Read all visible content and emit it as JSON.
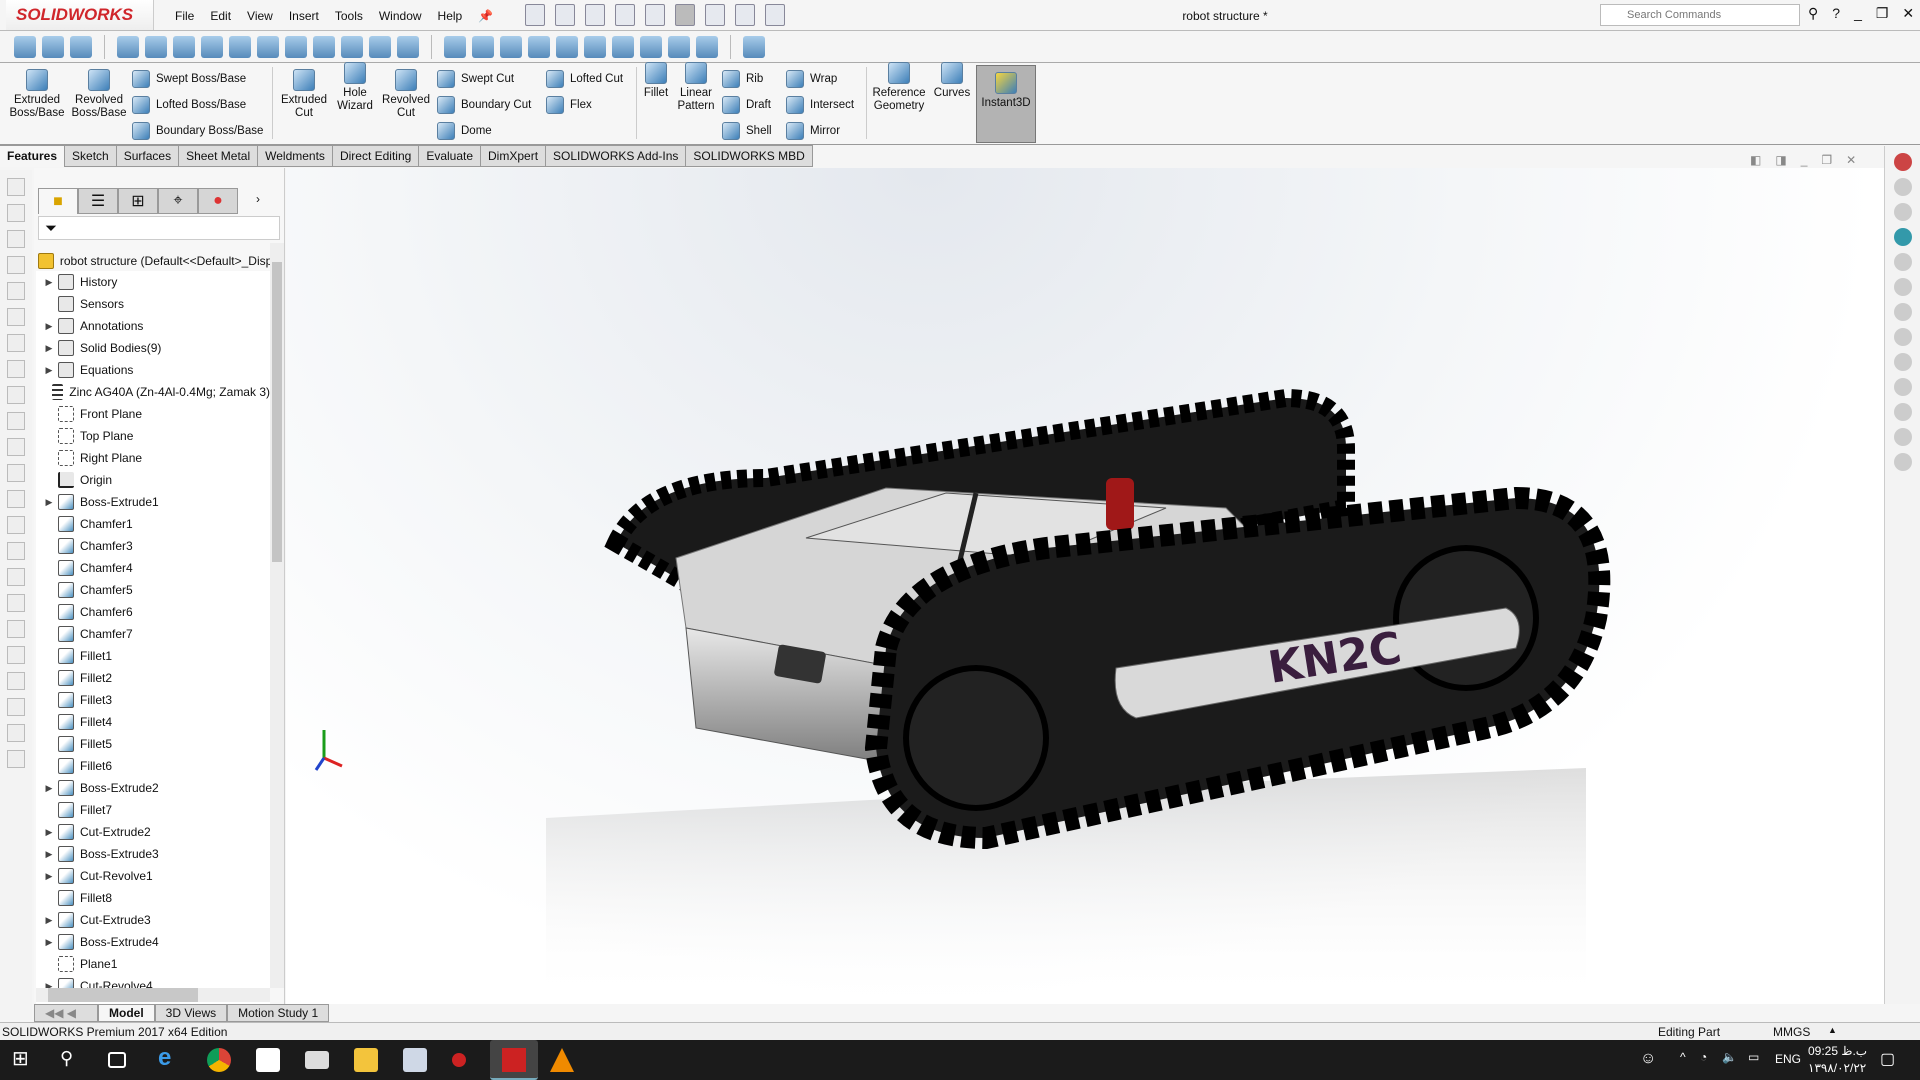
{
  "app": {
    "brand": "SOLIDWORKS",
    "title": "robot structure *",
    "search_placeholder": "Search Commands",
    "brand_color": "#d0262b"
  },
  "menus": [
    "File",
    "Edit",
    "View",
    "Insert",
    "Tools",
    "Window",
    "Help"
  ],
  "ribbon": {
    "large": [
      "Extruded Boss/Base",
      "Revolved Boss/Base",
      "Extruded Cut",
      "Hole Wizard",
      "Revolved Cut",
      "Fillet",
      "Linear Pattern",
      "Reference Geometry",
      "Curves",
      "Instant3D"
    ],
    "small": [
      "Swept Boss/Base",
      "Lofted Boss/Base",
      "Boundary Boss/Base",
      "Swept Cut",
      "Boundary Cut",
      "Dome",
      "Lofted Cut",
      "Flex",
      "Rib",
      "Draft",
      "Shell",
      "Wrap",
      "Intersect",
      "Mirror"
    ]
  },
  "cm_tabs": [
    "Features",
    "Sketch",
    "Surfaces",
    "Sheet Metal",
    "Weldments",
    "Direct Editing",
    "Evaluate",
    "DimXpert",
    "SOLIDWORKS Add-Ins",
    "SOLIDWORKS MBD"
  ],
  "tree": {
    "root": "robot structure  (Default<<Default>_Disp",
    "items": [
      {
        "label": "History",
        "icon": "folder",
        "exp": true
      },
      {
        "label": "Sensors",
        "icon": "folder",
        "exp": false
      },
      {
        "label": "Annotations",
        "icon": "folder",
        "exp": true
      },
      {
        "label": "Solid Bodies(9)",
        "icon": "folder",
        "exp": true
      },
      {
        "label": "Equations",
        "icon": "folder",
        "exp": true
      },
      {
        "label": "Zinc AG40A (Zn-4Al-0.4Mg; Zamak 3)",
        "icon": "material",
        "exp": false
      },
      {
        "label": "Front Plane",
        "icon": "plane",
        "exp": false
      },
      {
        "label": "Top Plane",
        "icon": "plane",
        "exp": false
      },
      {
        "label": "Right Plane",
        "icon": "plane",
        "exp": false
      },
      {
        "label": "Origin",
        "icon": "origin",
        "exp": false
      },
      {
        "label": "Boss-Extrude1",
        "icon": "feat",
        "exp": true
      },
      {
        "label": "Chamfer1",
        "icon": "feat",
        "exp": false
      },
      {
        "label": "Chamfer3",
        "icon": "feat",
        "exp": false
      },
      {
        "label": "Chamfer4",
        "icon": "feat",
        "exp": false
      },
      {
        "label": "Chamfer5",
        "icon": "feat",
        "exp": false
      },
      {
        "label": "Chamfer6",
        "icon": "feat",
        "exp": false
      },
      {
        "label": "Chamfer7",
        "icon": "feat",
        "exp": false
      },
      {
        "label": "Fillet1",
        "icon": "feat",
        "exp": false
      },
      {
        "label": "Fillet2",
        "icon": "feat",
        "exp": false
      },
      {
        "label": "Fillet3",
        "icon": "feat",
        "exp": false
      },
      {
        "label": "Fillet4",
        "icon": "feat",
        "exp": false
      },
      {
        "label": "Fillet5",
        "icon": "feat",
        "exp": false
      },
      {
        "label": "Fillet6",
        "icon": "feat",
        "exp": false
      },
      {
        "label": "Boss-Extrude2",
        "icon": "feat",
        "exp": true
      },
      {
        "label": "Fillet7",
        "icon": "feat",
        "exp": false
      },
      {
        "label": "Cut-Extrude2",
        "icon": "feat",
        "exp": true
      },
      {
        "label": "Boss-Extrude3",
        "icon": "feat",
        "exp": true
      },
      {
        "label": "Cut-Revolve1",
        "icon": "feat",
        "exp": true
      },
      {
        "label": "Fillet8",
        "icon": "feat",
        "exp": false
      },
      {
        "label": "Cut-Extrude3",
        "icon": "feat",
        "exp": true
      },
      {
        "label": "Boss-Extrude4",
        "icon": "feat",
        "exp": true
      },
      {
        "label": "Plane1",
        "icon": "plane",
        "exp": false
      },
      {
        "label": "Cut-Revolve4",
        "icon": "feat",
        "exp": true
      }
    ]
  },
  "bottom_tabs": [
    "Model",
    "3D Views",
    "Motion Study 1"
  ],
  "model": {
    "label": "KN2C",
    "label_color": "#3a1e3e"
  },
  "status": {
    "edition": "SOLIDWORKS Premium 2017 x64 Edition",
    "mode": "Editing Part",
    "units": "MMGS"
  },
  "taskbar": {
    "lang": "ENG",
    "time": "09:25 ب.ظ",
    "date": "۱۳۹۸/۰۲/۲۲"
  }
}
